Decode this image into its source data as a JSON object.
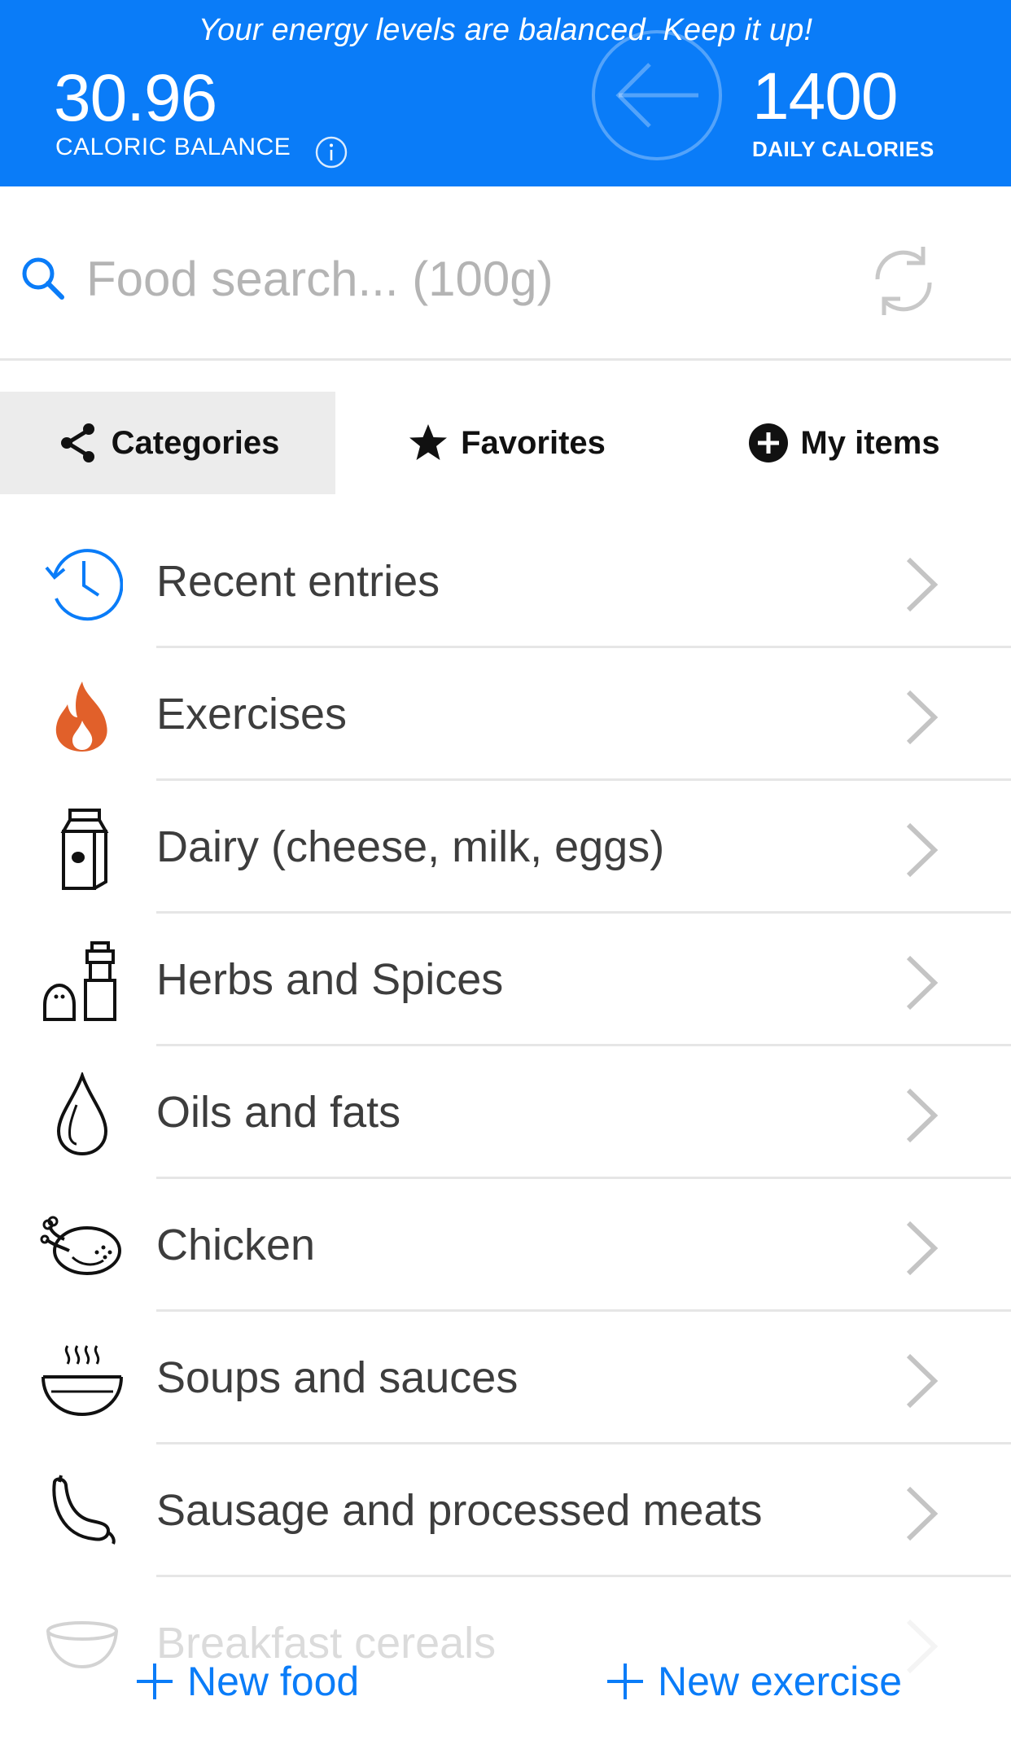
{
  "header": {
    "motivation": "Your energy levels are balanced. Keep it up!",
    "balance_value": "30.96",
    "balance_label": "CALORIC BALANCE",
    "daily_value": "1400",
    "daily_label": "DAILY CALORIES",
    "accent_color": "#0a7cf8"
  },
  "search": {
    "placeholder": "Food search... (100g)"
  },
  "tabs": [
    {
      "label": "Categories",
      "icon": "share-icon",
      "active": true
    },
    {
      "label": "Favorites",
      "icon": "star-icon",
      "active": false
    },
    {
      "label": "My items",
      "icon": "plus-circle-icon",
      "active": false
    }
  ],
  "categories": [
    {
      "label": "Recent entries",
      "icon": "history-icon"
    },
    {
      "label": "Exercises",
      "icon": "fire-icon"
    },
    {
      "label": "Dairy (cheese, milk, eggs)",
      "icon": "milk-carton-icon"
    },
    {
      "label": "Herbs and Spices",
      "icon": "salt-pepper-icon"
    },
    {
      "label": "Oils and fats",
      "icon": "oil-drop-icon"
    },
    {
      "label": "Chicken",
      "icon": "roast-chicken-icon"
    },
    {
      "label": "Soups and sauces",
      "icon": "soup-bowl-icon"
    },
    {
      "label": "Sausage and processed meats",
      "icon": "sausage-icon"
    },
    {
      "label": "Breakfast cereals",
      "icon": "cereal-bowl-icon"
    }
  ],
  "actions": {
    "new_food": "New food",
    "new_exercise": "New exercise"
  }
}
